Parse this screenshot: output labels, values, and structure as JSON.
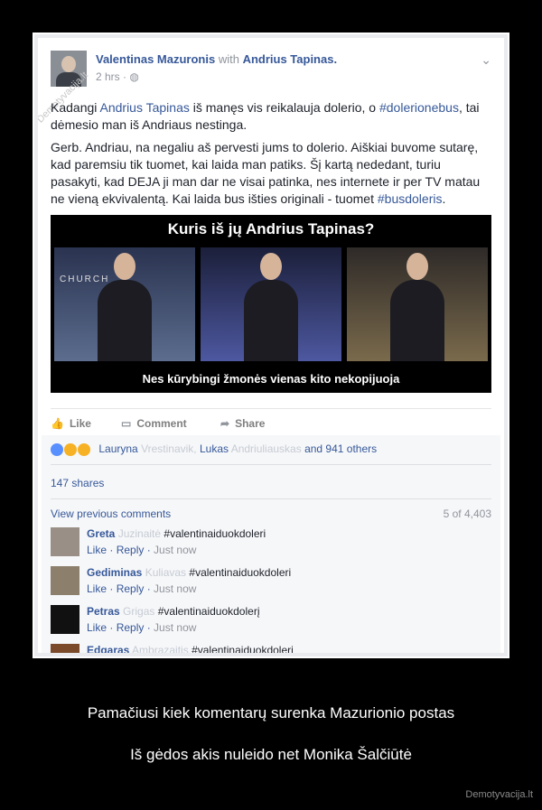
{
  "post": {
    "author": "Valentinas Mazuronis",
    "with_text": "with",
    "tagged": "Andrius Tapinas.",
    "time": "2 hrs · ◍",
    "p1_before": "Kadangi ",
    "p1_link1": "Andrius Tapinas",
    "p1_middle": " iš manęs vis reikalauja dolerio, o ",
    "p1_link2": "#dolerionebus",
    "p1_after": ", tai dėmesio man iš Andriaus nestinga.",
    "p2_text": "Gerb. Andriau, na negaliu aš pervesti jums to dolerio. Aiškiai buvome sutarę, kad paremsiu tik tuomet, kai laida man patiks. Šį kartą nededant, turiu pasakyti, kad DEJA ji man dar ne visai patinka, nes internete ir per TV matau ne vieną ekvivalentą. Kai laida bus išties originali - tuomet ",
    "p2_link": "#busdoleris",
    "p2_end": "."
  },
  "banner": {
    "title": "Kuris iš jų Andrius Tapinas?",
    "caption": "Nes kūrybingi žmonės vienas kito nekopijuoja",
    "panel1_text": "CHURCH"
  },
  "actions": {
    "like": "Like",
    "comment": "Comment",
    "share": "Share"
  },
  "reactions": {
    "name1": "Lauryna",
    "name1_blur": "Vrestinavik,",
    "name2": "Lukas",
    "name2_blur": "Andriuliauskas",
    "others": "and 941 others"
  },
  "shares": "147 shares",
  "comments_header": {
    "view_previous": "View previous comments",
    "count": "5 of 4,403"
  },
  "comments": [
    {
      "name": "Greta",
      "name_blur": "Juzinaitė",
      "text": "#valentinaiduokdoleri",
      "like": "Like",
      "reply": "Reply",
      "time": "Just now"
    },
    {
      "name": "Gediminas",
      "name_blur": "Kuliavas",
      "text": "#valentinaiduokdoleri",
      "like": "Like",
      "reply": "Reply",
      "time": "Just now"
    },
    {
      "name": "Petras",
      "name_blur": "Grigas",
      "text": "#valentinaiduokdolerį",
      "like": "Like",
      "reply": "Reply",
      "time": "Just now"
    },
    {
      "name": "Edgaras",
      "name_blur": "Ambrazaitis",
      "text": "#valentinaiduokdolerį"
    }
  ],
  "watermark": "Demotyvacija.lt",
  "bottom_line1": "Pamačiusi kiek komentarų surenka Mazurionio postas",
  "bottom_line2": "Iš gėdos akis nuleido net Monika Šalčiūtė",
  "site": "Demotyvacija.lt",
  "colors": {
    "fb_link": "#365899",
    "frame_bg": "#000000"
  }
}
